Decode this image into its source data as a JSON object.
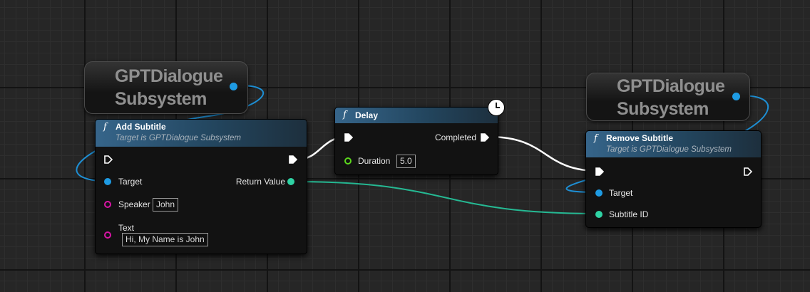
{
  "colors": {
    "object_pin": "#1e9be3",
    "int_pin": "#2fd3a4",
    "string_pin": "#d914a6",
    "float_pin": "#5bd61d",
    "exec_pin": "#ffffff",
    "header": "#2e5a7a"
  },
  "subsystem_nodes": [
    {
      "label": "GPTDialogue\nSubsystem",
      "icon": "object-pin"
    },
    {
      "label": "GPTDialogue\nSubsystem",
      "icon": "object-pin"
    }
  ],
  "add_subtitle": {
    "icon": "function-icon",
    "title": "Add Subtitle",
    "subtitle": "Target is GPTDialogue Subsystem",
    "pins": {
      "target": "Target",
      "speaker": "Speaker",
      "speaker_value": "John",
      "text": "Text",
      "text_value": "Hi, My Name is John",
      "return_value": "Return Value"
    }
  },
  "delay": {
    "icon": "function-icon",
    "title": "Delay",
    "pins": {
      "completed": "Completed",
      "duration": "Duration",
      "duration_value": "5.0"
    },
    "badge_icon": "clock-icon"
  },
  "remove_subtitle": {
    "icon": "function-icon",
    "title": "Remove Subtitle",
    "subtitle": "Target is GPTDialogue Subsystem",
    "pins": {
      "target": "Target",
      "subtitle_id": "Subtitle ID"
    }
  }
}
